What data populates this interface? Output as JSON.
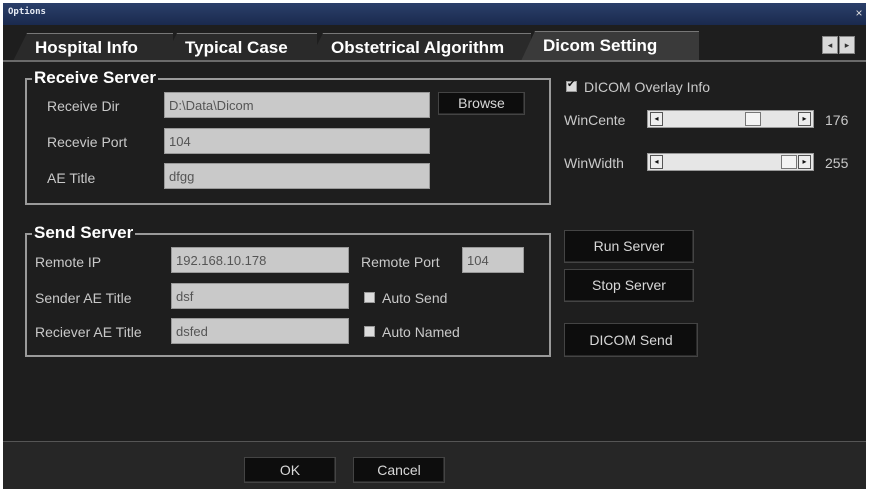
{
  "window": {
    "title": "Options",
    "close_glyph": "×"
  },
  "tabs": [
    {
      "label": "Hospital Info"
    },
    {
      "label": "Typical Case"
    },
    {
      "label": "Obstetrical Algorithm"
    },
    {
      "label": "Dicom Setting",
      "active": true
    }
  ],
  "tab_scroll": {
    "left_glyph": "◂",
    "right_glyph": "▸"
  },
  "receive_server": {
    "title": "Receive Server",
    "receive_dir_label": "Receive Dir",
    "receive_dir_value": "D:\\Data\\Dicom",
    "browse_label": "Browse",
    "port_label": "Recevie Port",
    "port_value": "104",
    "ae_title_label": "AE  Title",
    "ae_title_value": "dfgg"
  },
  "send_server": {
    "title": "Send Server",
    "remote_ip_label": "Remote IP",
    "remote_ip_value": "192.168.10.178",
    "remote_port_label": "Remote Port",
    "remote_port_value": "104",
    "sender_ae_label": "Sender AE Title",
    "sender_ae_value": "dsf",
    "receiver_ae_label": "Reciever AE Title",
    "receiver_ae_value": "dsfed",
    "auto_send_label": "Auto Send",
    "auto_send_checked": false,
    "auto_named_label": "Auto Named",
    "auto_named_checked": false
  },
  "overlay": {
    "label": "DICOM Overlay Info",
    "checked": true
  },
  "win_center": {
    "label": "WinCente",
    "value": "176",
    "fraction": 0.69
  },
  "win_width": {
    "label": "WinWidth",
    "value": "255",
    "fraction": 1.0
  },
  "buttons": {
    "run_server": "Run Server",
    "stop_server": "Stop Server",
    "dicom_send": "DICOM Send",
    "ok": "OK",
    "cancel": "Cancel"
  },
  "colors": {
    "background": "#1e1e1e",
    "field": "#c9c9c9",
    "titlebar": "#1a2a4e"
  }
}
